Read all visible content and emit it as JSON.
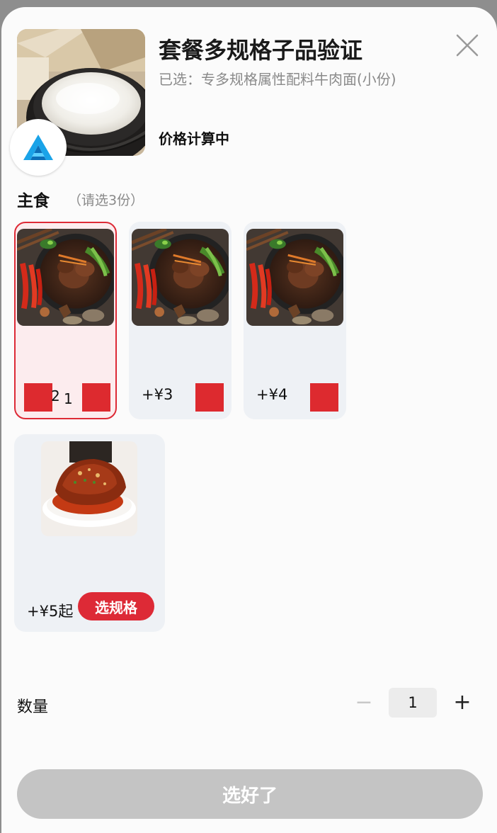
{
  "header": {
    "title": "套餐多规格子品验证",
    "subtitle": "已选：专多规格属性配料牛肉面(小份)",
    "price_status": "价格计算中"
  },
  "section": {
    "title": "主食",
    "hint": "（请选3份）"
  },
  "items": [
    {
      "dish": "beef-noodle",
      "qty_left": "2",
      "qty_right": "1",
      "selected": true
    },
    {
      "dish": "beef-noodle",
      "price": "+¥3"
    },
    {
      "dish": "beef-noodle",
      "price": "+¥4"
    },
    {
      "dish": "braised-pork",
      "price": "+¥5起",
      "spec_button": "选规格"
    }
  ],
  "quantity": {
    "label": "数量",
    "minus": "−",
    "value": "1",
    "plus": "+"
  },
  "confirm_button": "选好了",
  "colors": {
    "accent": "#dd2a36",
    "selected_bg": "#fcecee",
    "card_bg": "#eef1f5",
    "disabled_button": "#c4c4c4"
  }
}
